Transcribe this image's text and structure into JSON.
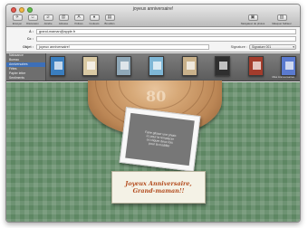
{
  "window": {
    "title": "joyeux anniversaire!"
  },
  "toolbar": {
    "left": [
      {
        "label": "Envoyer"
      },
      {
        "label": "Discussion"
      },
      {
        "label": "Joindre"
      },
      {
        "label": "Adresse"
      },
      {
        "label": "Polices"
      },
      {
        "label": "Couleurs"
      },
      {
        "label": "Brouillon"
      }
    ],
    "right": [
      {
        "label": "Navigateur de photos"
      },
      {
        "label": "Masquer l'éditeur"
      }
    ]
  },
  "headers": {
    "to_label": "À :",
    "to_value": "grand-maman@apple.fr",
    "cc_label": "Cc :",
    "cc_value": "",
    "subject_label": "Objet :",
    "subject_value": "joyeux anniversaire!",
    "signature_label": "Signature :",
    "signature_value": "Signature 001"
  },
  "stationery": {
    "categories": [
      "Naissance",
      "Bureau",
      "Anniversaires",
      "Fêtes",
      "Papier lettre",
      "Sentiments"
    ],
    "active_index": 2,
    "thumb_colors": [
      "#3a7ebf",
      "#d9c9a3",
      "#8fa8b8",
      "#7fb7d6",
      "#c9b18a",
      "#2f2f2f",
      "#a33c2c",
      "#5a7ad0"
    ],
    "caption": "Mes Anniversaires"
  },
  "card": {
    "stump_number": "80",
    "photo_lines": [
      "Faire glisser une photo",
      "ici pour la remplacer",
      "ou cliquer deux fois",
      "pour la modifier"
    ],
    "greeting_line1": "Joyeux Anniversaire,",
    "greeting_line2": "Grand-maman!!"
  }
}
